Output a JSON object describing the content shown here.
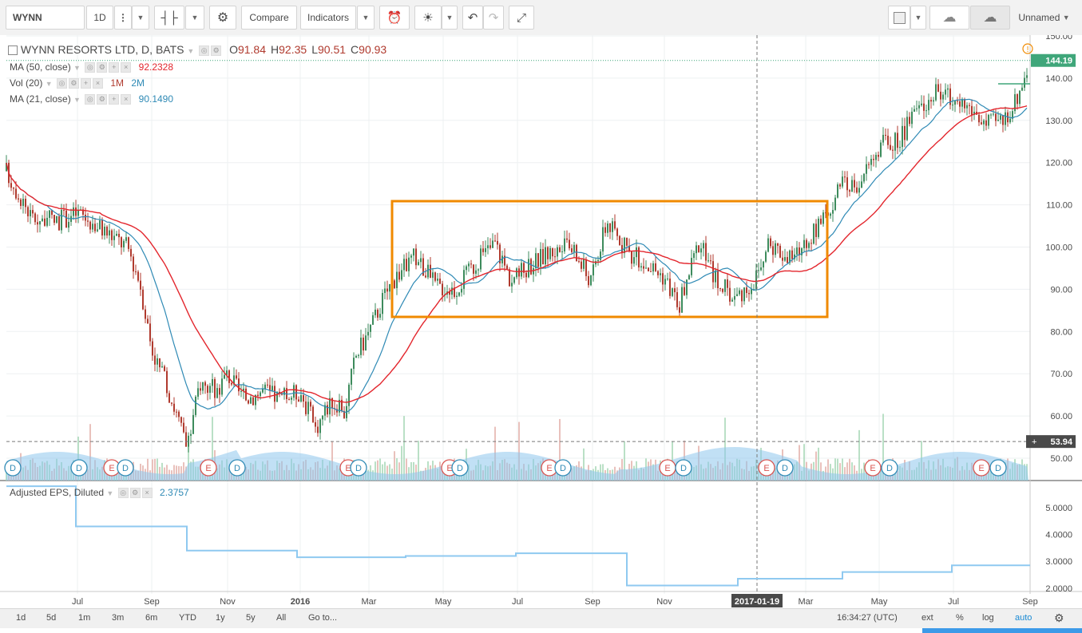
{
  "toolbar": {
    "symbol": "WYNN",
    "interval": "1D",
    "compare_label": "Compare",
    "indicators_label": "Indicators",
    "layout_name": "Unnamed"
  },
  "legend": {
    "title": "WYNN RESORTS LTD, D, BATS",
    "ohlc": [
      {
        "k": "O",
        "v": "91.84"
      },
      {
        "k": "H",
        "v": "92.35"
      },
      {
        "k": "L",
        "v": "90.51"
      },
      {
        "k": "C",
        "v": "90.93"
      }
    ],
    "ma50_label": "MA (50, close)",
    "ma50_value": "92.2328",
    "vol_label": "Vol (20)",
    "vol_v1": "1M",
    "vol_v2": "2M",
    "ma21_label": "MA (21, close)",
    "ma21_value": "90.1490",
    "eps_label": "Adjusted EPS, Diluted",
    "eps_value": "2.3757"
  },
  "price_axis": {
    "ticks": [
      "150.00",
      "140.00",
      "130.00",
      "120.00",
      "110.00",
      "100.00",
      "90.00",
      "80.00",
      "70.00",
      "60.00",
      "50.00"
    ],
    "last_price": "144.19",
    "crosshair_price": "53.94"
  },
  "eps_axis": {
    "ticks": [
      "5.0000",
      "4.0000",
      "3.0000",
      "2.0000"
    ]
  },
  "time_axis": {
    "labels": [
      "Jul",
      "Sep",
      "Nov",
      "2016",
      "Mar",
      "May",
      "Jul",
      "Sep",
      "Nov",
      "Mar",
      "May",
      "Jul",
      "Sep"
    ],
    "crosshair_date": "2017-01-19"
  },
  "events": {
    "dividend_letter": "D",
    "earnings_letter": "E"
  },
  "bottom": {
    "ranges": [
      "1d",
      "5d",
      "1m",
      "3m",
      "6m",
      "YTD",
      "1y",
      "5y",
      "All"
    ],
    "goto": "Go to...",
    "time": "16:34:27 (UTC)",
    "ext": "ext",
    "percent": "%",
    "log": "log",
    "auto": "auto"
  },
  "colors": {
    "candle_up": "#3d8b5c",
    "candle_down": "#b03a2e",
    "ma50": "#e3262d",
    "ma21": "#2f8ab5",
    "volume": "#8ec6ec",
    "eps_line": "#8fc9f0",
    "highlight_box": "#f08a00",
    "last_price_tag": "#3fa67a",
    "accent": "#1a8ad4"
  }
}
